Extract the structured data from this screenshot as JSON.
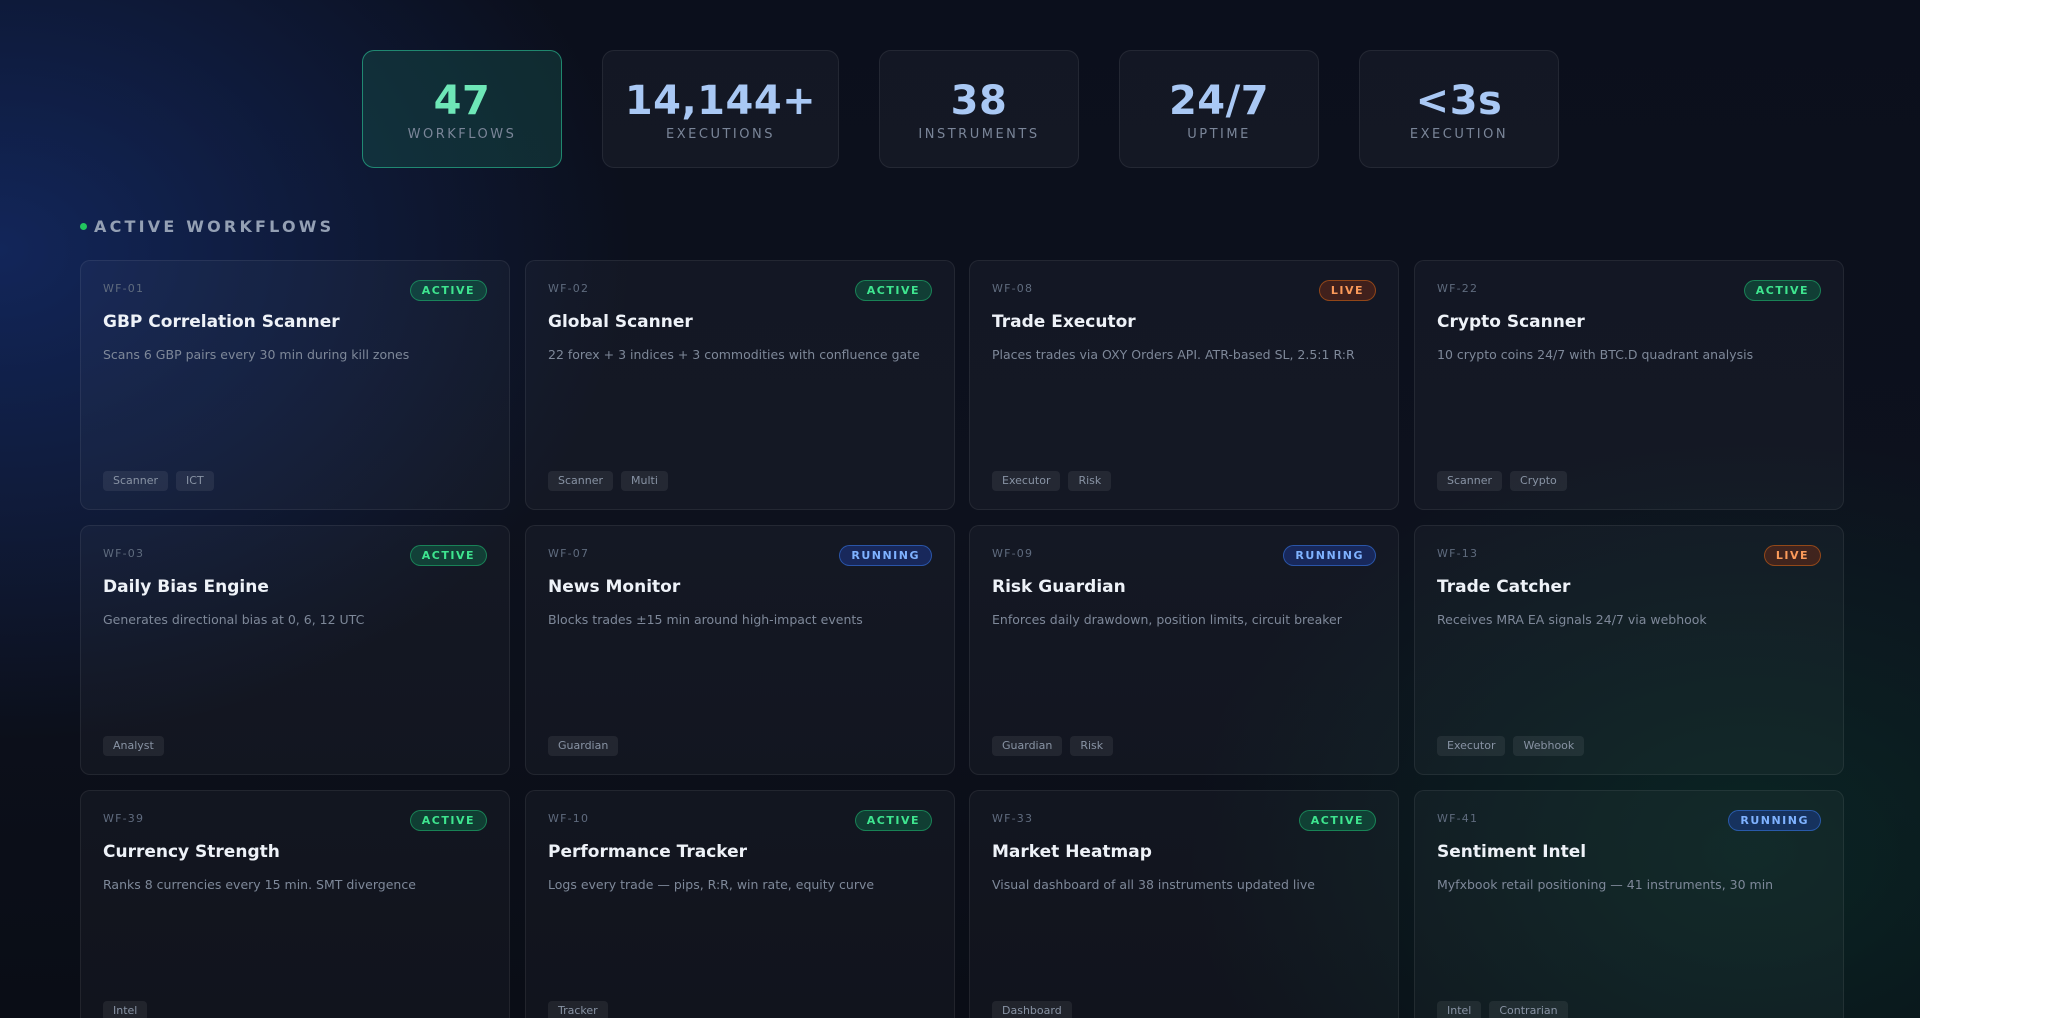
{
  "stats": [
    {
      "value": "47",
      "label": "WORKFLOWS"
    },
    {
      "value": "14,144+",
      "label": "EXECUTIONS"
    },
    {
      "value": "38",
      "label": "INSTRUMENTS"
    },
    {
      "value": "24/7",
      "label": "UPTIME"
    },
    {
      "value": "<3s",
      "label": "EXECUTION"
    }
  ],
  "section": {
    "title": "ACTIVE WORKFLOWS"
  },
  "workflows": [
    {
      "id": "WF-01",
      "status": "ACTIVE",
      "title": "GBP Correlation Scanner",
      "desc": "Scans 6 GBP pairs every 30 min during kill zones",
      "tags": [
        "Scanner",
        "ICT"
      ]
    },
    {
      "id": "WF-02",
      "status": "ACTIVE",
      "title": "Global Scanner",
      "desc": "22 forex + 3 indices + 3 commodities with confluence gate",
      "tags": [
        "Scanner",
        "Multi"
      ]
    },
    {
      "id": "WF-08",
      "status": "LIVE",
      "title": "Trade Executor",
      "desc": "Places trades via OXY Orders API. ATR-based SL, 2.5:1 R:R",
      "tags": [
        "Executor",
        "Risk"
      ]
    },
    {
      "id": "WF-22",
      "status": "ACTIVE",
      "title": "Crypto Scanner",
      "desc": "10 crypto coins 24/7 with BTC.D quadrant analysis",
      "tags": [
        "Scanner",
        "Crypto"
      ]
    },
    {
      "id": "WF-03",
      "status": "ACTIVE",
      "title": "Daily Bias Engine",
      "desc": "Generates directional bias at 0, 6, 12 UTC",
      "tags": [
        "Analyst"
      ]
    },
    {
      "id": "WF-07",
      "status": "RUNNING",
      "title": "News Monitor",
      "desc": "Blocks trades ±15 min around high-impact events",
      "tags": [
        "Guardian"
      ]
    },
    {
      "id": "WF-09",
      "status": "RUNNING",
      "title": "Risk Guardian",
      "desc": "Enforces daily drawdown, position limits, circuit breaker",
      "tags": [
        "Guardian",
        "Risk"
      ]
    },
    {
      "id": "WF-13",
      "status": "LIVE",
      "title": "Trade Catcher",
      "desc": "Receives MRA EA signals 24/7 via webhook",
      "tags": [
        "Executor",
        "Webhook"
      ]
    },
    {
      "id": "WF-39",
      "status": "ACTIVE",
      "title": "Currency Strength",
      "desc": "Ranks 8 currencies every 15 min. SMT divergence",
      "tags": [
        "Intel"
      ]
    },
    {
      "id": "WF-10",
      "status": "ACTIVE",
      "title": "Performance Tracker",
      "desc": "Logs every trade — pips, R:R, win rate, equity curve",
      "tags": [
        "Tracker"
      ]
    },
    {
      "id": "WF-33",
      "status": "ACTIVE",
      "title": "Market Heatmap",
      "desc": "Visual dashboard of all 38 instruments updated live",
      "tags": [
        "Dashboard"
      ]
    },
    {
      "id": "WF-41",
      "status": "RUNNING",
      "title": "Sentiment Intel",
      "desc": "Myfxbook retail positioning — 41 instruments, 30 min",
      "tags": [
        "Intel",
        "Contrarian"
      ]
    }
  ]
}
